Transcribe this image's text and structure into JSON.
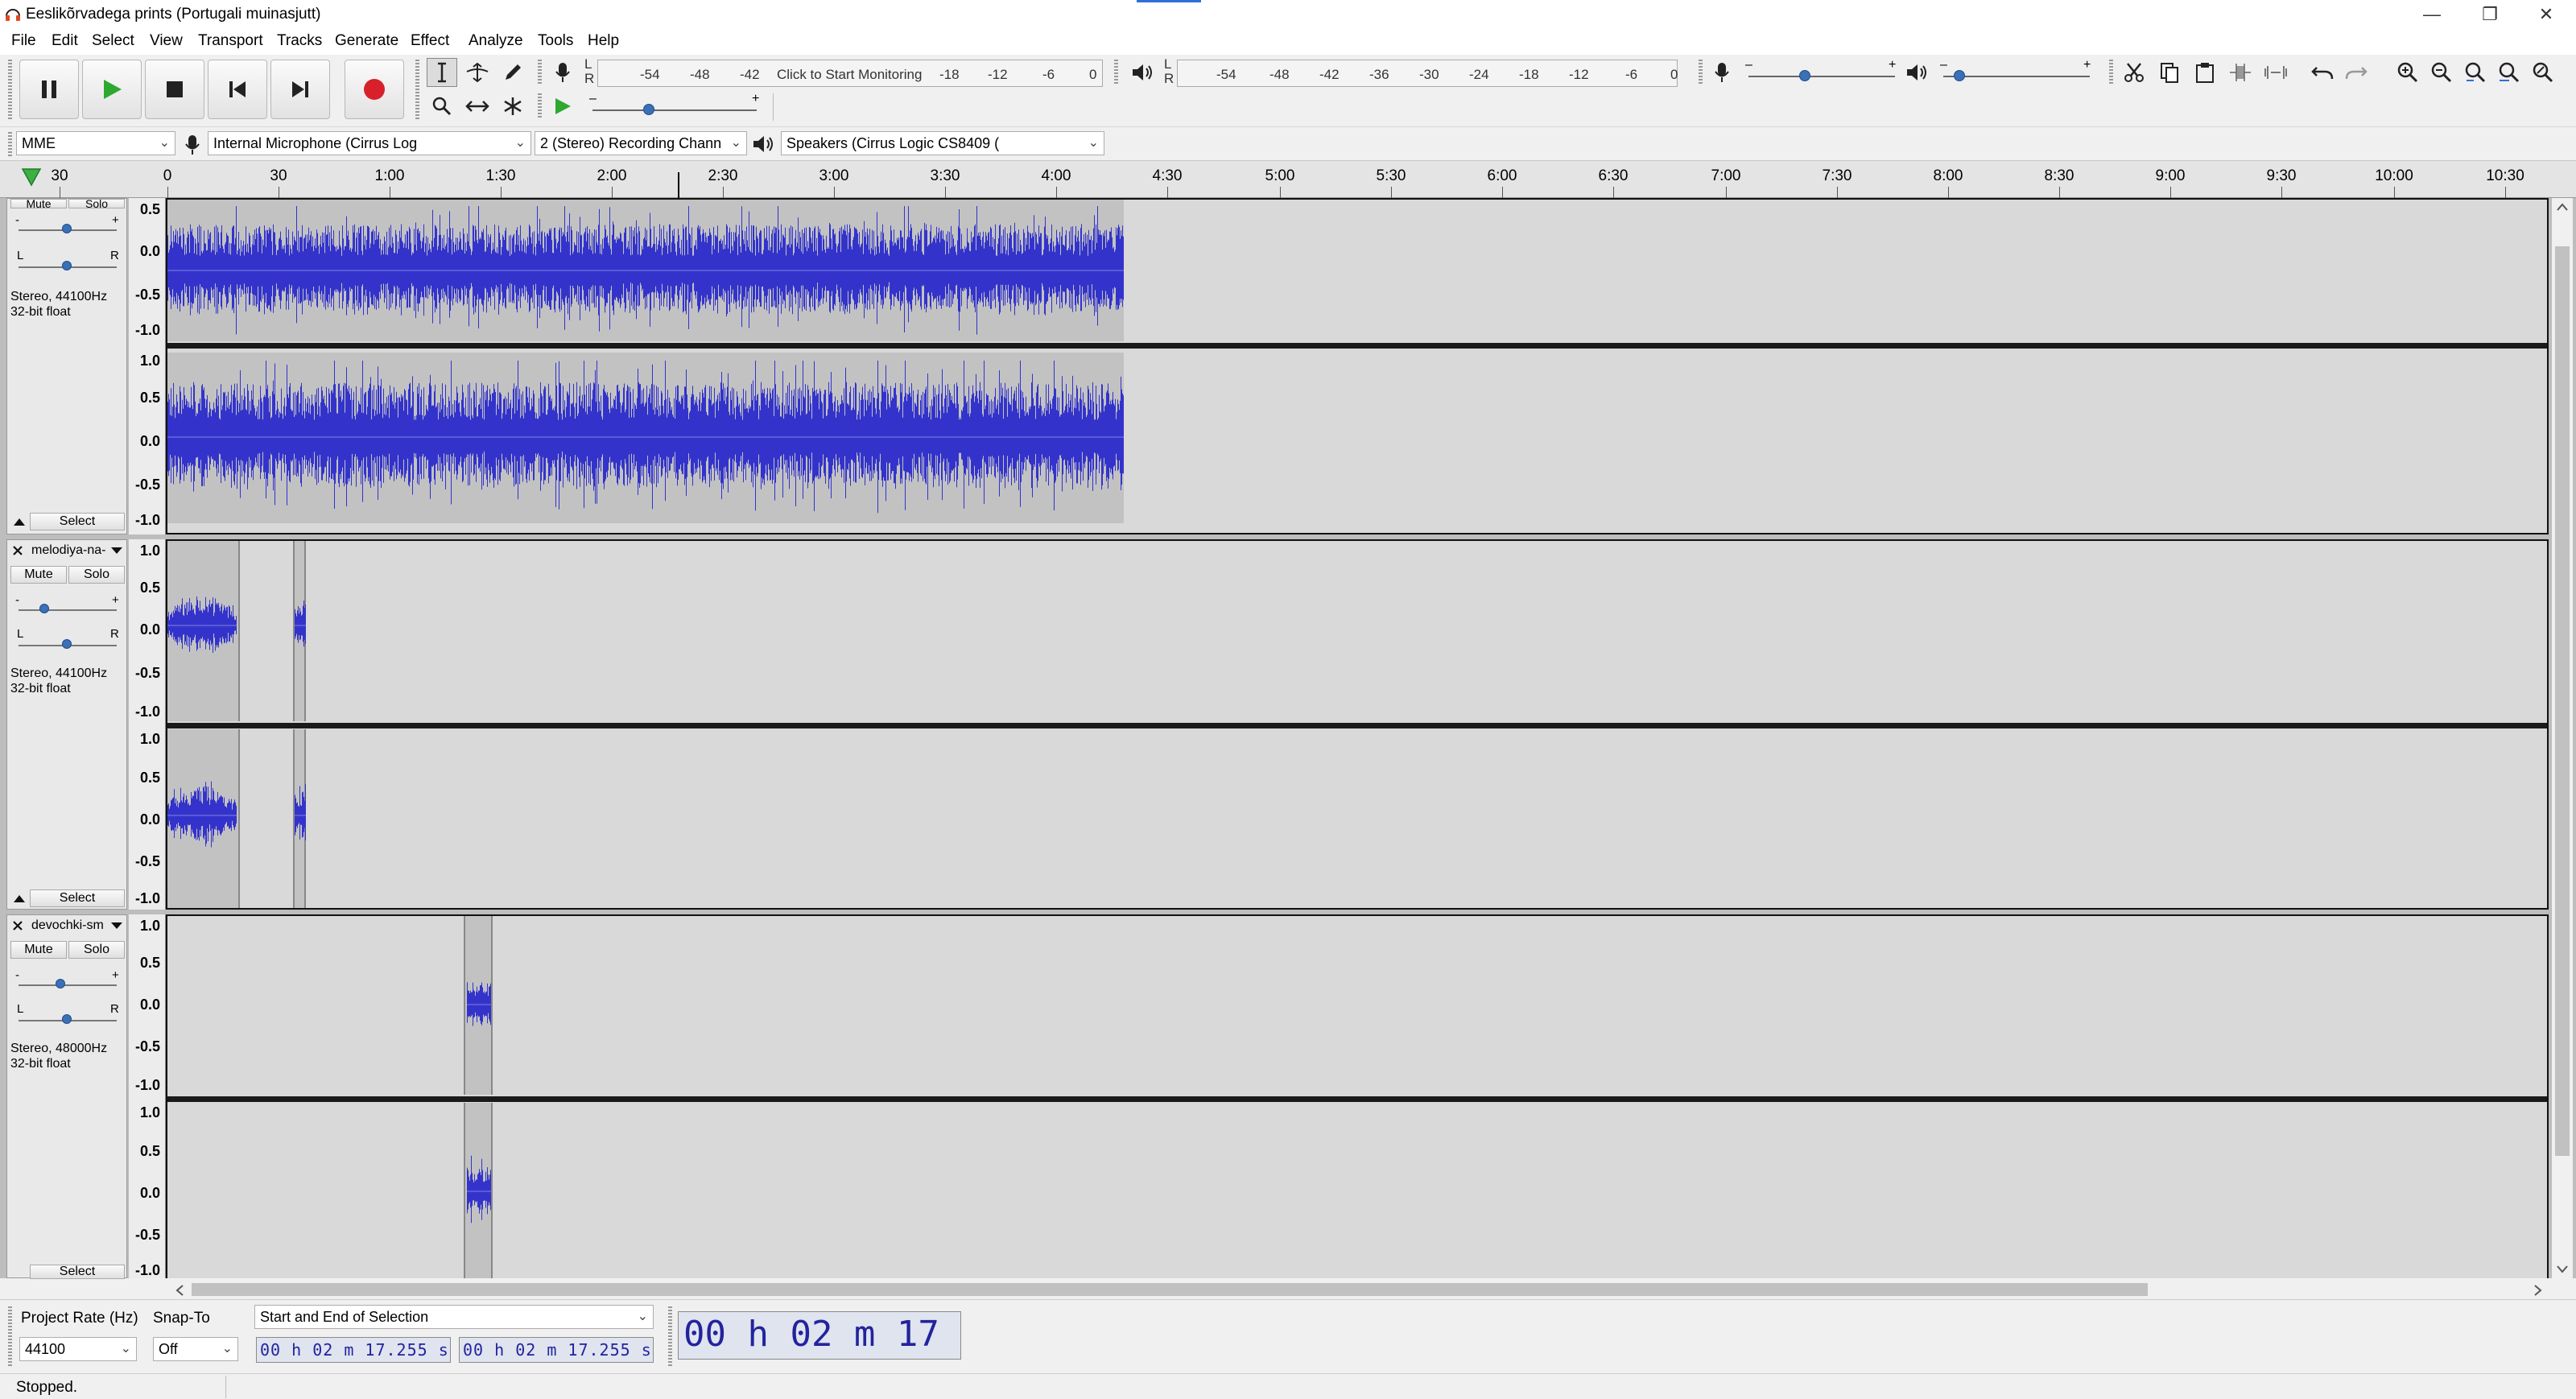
{
  "window": {
    "title": "Eeslikõrvadega prints (Portugali muinasjutt)",
    "controls": [
      "minimize",
      "restore",
      "close"
    ]
  },
  "menu": [
    "File",
    "Edit",
    "Select",
    "View",
    "Transport",
    "Tracks",
    "Generate",
    "Effect",
    "Analyze",
    "Tools",
    "Help"
  ],
  "transport": {
    "buttons": [
      "pause",
      "play",
      "stop",
      "skip-to-start",
      "skip-to-end",
      "record"
    ]
  },
  "meters": {
    "record": {
      "lr": [
        "L",
        "R"
      ],
      "scale": [
        "-54",
        "-48",
        "-42"
      ],
      "monitor_text": "Click to Start Monitoring",
      "scale_tail": [
        "-18",
        "-12",
        "-6",
        "0"
      ]
    },
    "playback": {
      "lr": [
        "L",
        "R"
      ],
      "scale": [
        "-54",
        "-48",
        "-42",
        "-36",
        "-30",
        "-24",
        "-18",
        "-12",
        "-6",
        "0"
      ]
    }
  },
  "mixer": {
    "record_volume_level": 0.4,
    "playback_volume_level": 0.1,
    "play_at_speed_level": 0.35
  },
  "devices": {
    "host": "MME",
    "input": "Internal Microphone (Cirrus Log",
    "channels": "2 (Stereo) Recording Chann",
    "output": "Speakers (Cirrus Logic CS8409 ("
  },
  "ruler": {
    "labels": [
      "30",
      "30",
      "0",
      "30",
      "1:00",
      "1:30",
      "2:00",
      "2:30",
      "3:00",
      "3:30",
      "4:00",
      "4:30",
      "5:00",
      "5:30",
      "6:00",
      "6:30",
      "7:00",
      "7:30",
      "8:00",
      "8:30",
      "9:00",
      "9:30",
      "10:00",
      "10:30"
    ]
  },
  "tracks": [
    {
      "name": "",
      "mute": "Mute",
      "solo": "Solo",
      "info1": "Stereo, 44100Hz",
      "info2": "32-bit float",
      "select": "Select",
      "scale_top": [
        "0.5",
        "0.0",
        "-0.5",
        "-1.0"
      ],
      "scale_bottom": [
        "1.0",
        "0.5",
        "0.0",
        "-0.5",
        "-1.0"
      ]
    },
    {
      "name": "melodiya-na-",
      "mute": "Mute",
      "solo": "Solo",
      "info1": "Stereo, 44100Hz",
      "info2": "32-bit float",
      "select": "Select",
      "scale_top": [
        "1.0",
        "0.5",
        "0.0",
        "-0.5",
        "-1.0"
      ],
      "scale_bottom": [
        "1.0",
        "0.5",
        "0.0",
        "-0.5",
        "-1.0"
      ]
    },
    {
      "name": "devochki-sm",
      "mute": "Mute",
      "solo": "Solo",
      "info1": "Stereo, 48000Hz",
      "info2": "32-bit float",
      "select": "Select",
      "scale_top": [
        "1.0",
        "0.5",
        "0.0",
        "-0.5",
        "-1.0"
      ],
      "scale_bottom": [
        "1.0",
        "0.5",
        "0.0",
        "-0.5",
        "-1.0"
      ]
    }
  ],
  "selection": {
    "project_rate_label": "Project Rate (Hz)",
    "snap_to_label": "Snap-To",
    "project_rate": "44100",
    "snap_to": "Off",
    "selection_mode": "Start and End of Selection",
    "start": "00 h 02 m 17.255 s",
    "end": "00 h 02 m 17.255 s",
    "position": "00 h 02 m 17 s"
  },
  "status": "Stopped.",
  "colors": {
    "waveform": "#3333cc",
    "clip": "#c2c2c2",
    "lane": "#d9d9d9",
    "record": "#d8202a",
    "play": "#2fa82f"
  }
}
